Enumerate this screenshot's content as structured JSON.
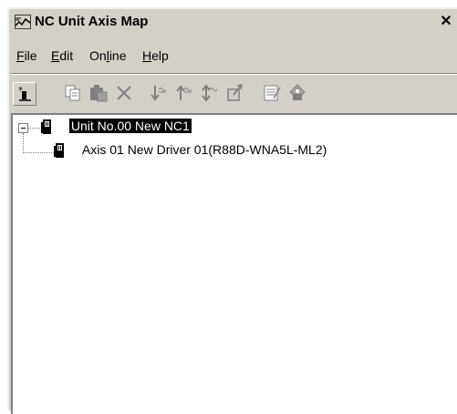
{
  "window": {
    "title": "NC Unit Axis Map",
    "close_glyph": "✕"
  },
  "menu": [
    {
      "label_pre": "",
      "label_u": "F",
      "label_post": "ile"
    },
    {
      "label_pre": "",
      "label_u": "E",
      "label_post": "dit"
    },
    {
      "label_pre": "On",
      "label_u": "l",
      "label_post": "ine"
    },
    {
      "label_pre": "",
      "label_u": "H",
      "label_post": "elp"
    }
  ],
  "toolbar": {
    "buttons": [
      {
        "icon": "new-unit-icon",
        "enabled": true
      },
      {
        "icon": "copy-icon",
        "enabled": false
      },
      {
        "icon": "paste-icon",
        "enabled": false
      },
      {
        "icon": "delete-icon",
        "enabled": false
      },
      {
        "icon": "download-icon",
        "enabled": false
      },
      {
        "icon": "upload-icon",
        "enabled": false
      },
      {
        "icon": "compare-icon",
        "enabled": false
      },
      {
        "icon": "transfer-icon",
        "enabled": false
      },
      {
        "icon": "properties-icon",
        "enabled": false
      },
      {
        "icon": "monitor-icon",
        "enabled": false
      }
    ]
  },
  "tree": {
    "root": {
      "label": "Unit No.00 New NC1",
      "selected": true,
      "expanded": true,
      "icon": "unit-icon"
    },
    "children": [
      {
        "label": "Axis 01 New Driver 01(R88D-WNA5L-ML2)",
        "icon": "driver-icon"
      }
    ]
  }
}
